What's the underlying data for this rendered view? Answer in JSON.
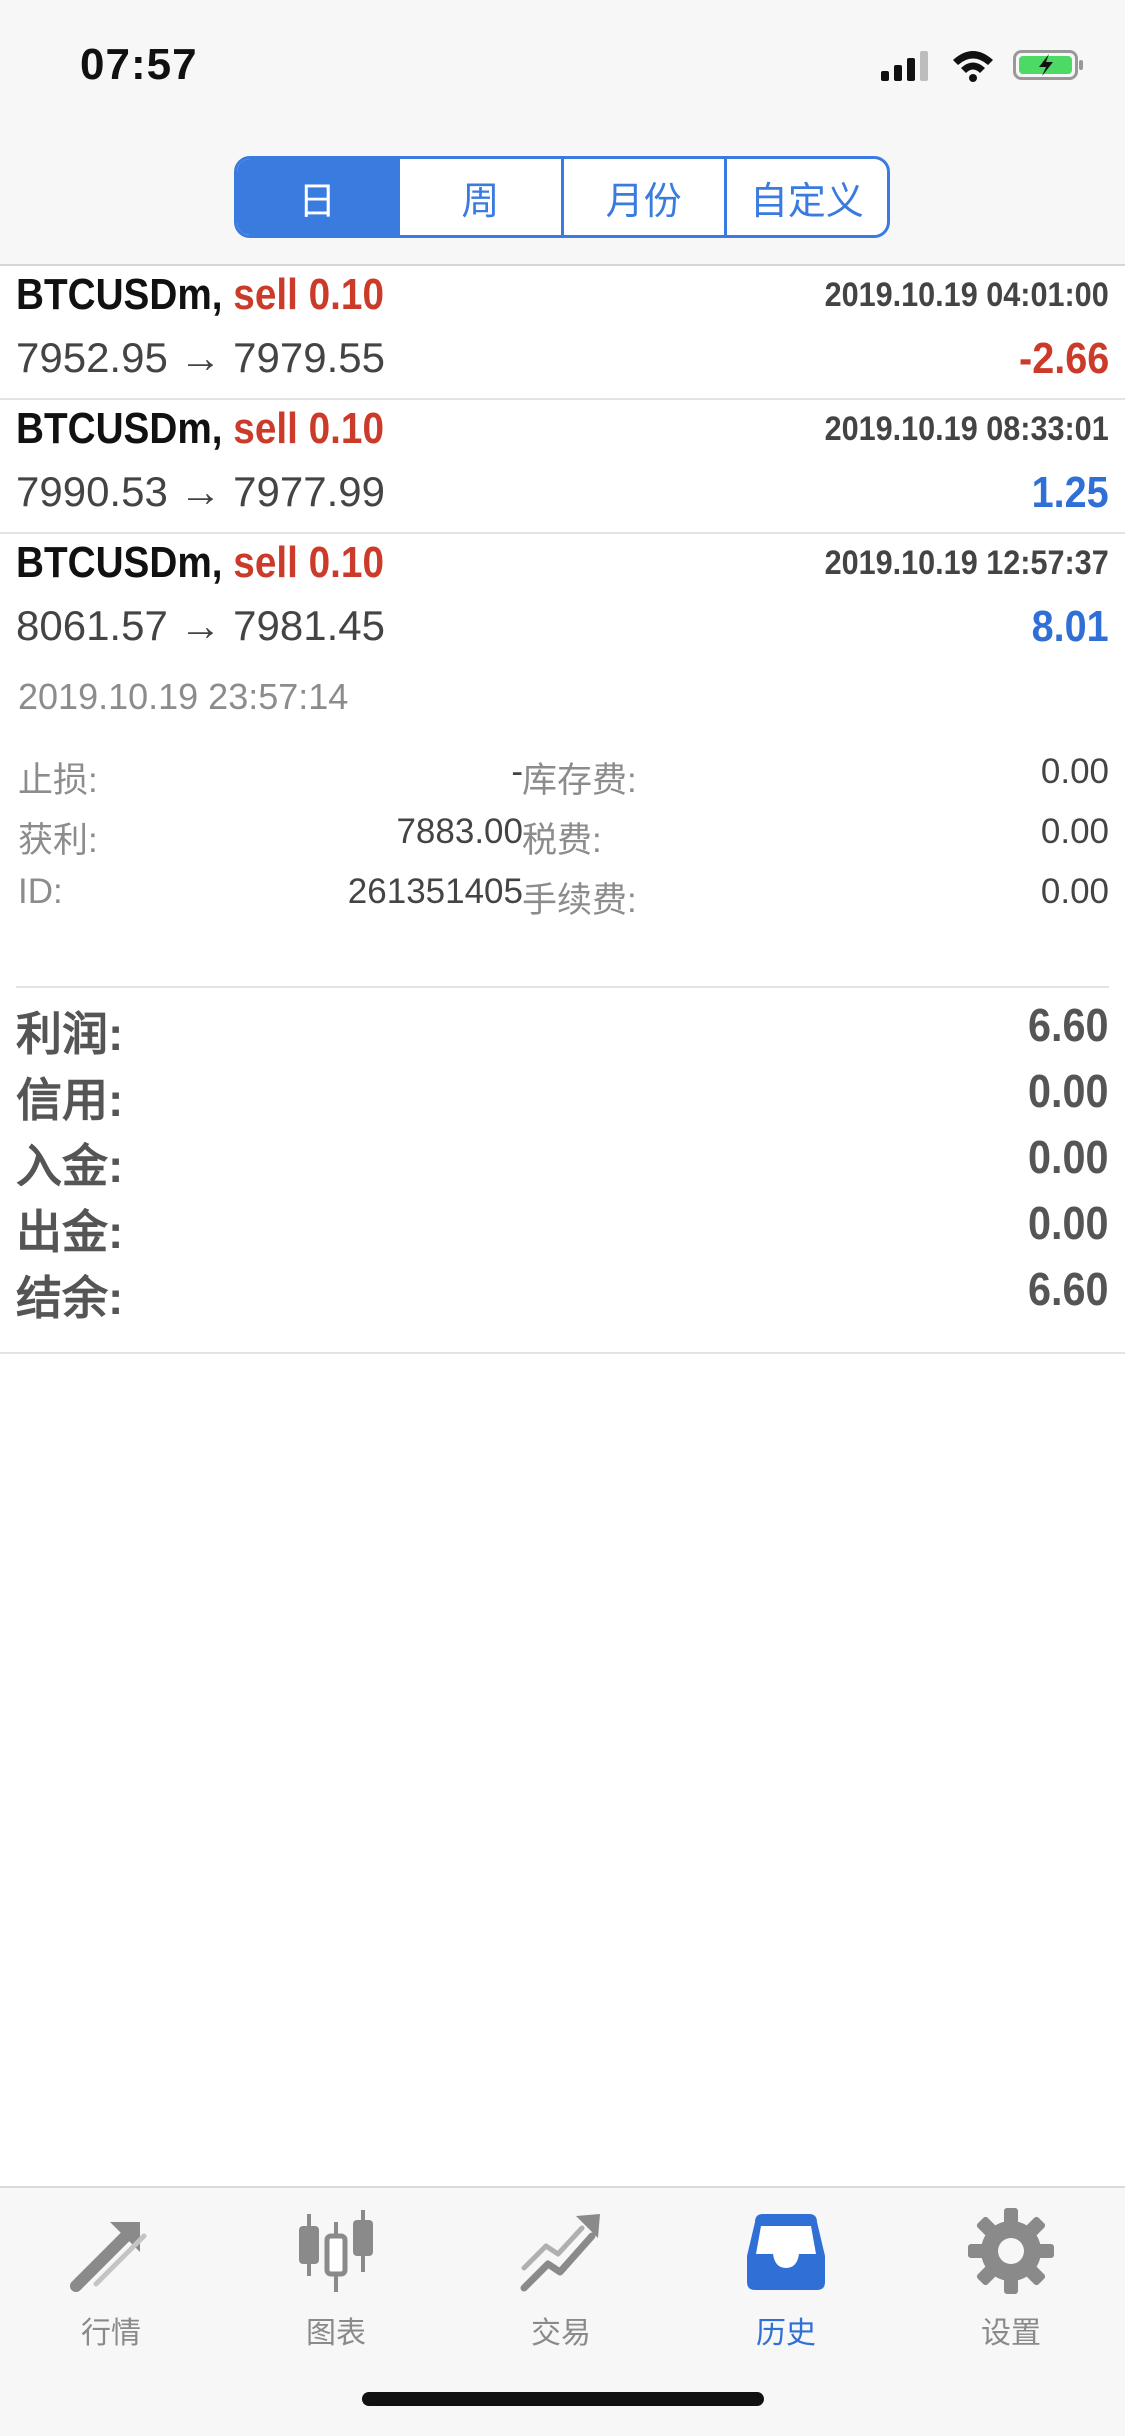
{
  "status_bar": {
    "time": "07:57"
  },
  "period_tabs": [
    {
      "label": "日",
      "active": true
    },
    {
      "label": "周",
      "active": false
    },
    {
      "label": "月份",
      "active": false
    },
    {
      "label": "自定义",
      "active": false
    }
  ],
  "trades": [
    {
      "symbol": "BTCUSDm,",
      "side": "sell 0.10",
      "time": "2019.10.19 04:01:00",
      "price": "7952.95 → 7979.55",
      "profit": "-2.66"
    },
    {
      "symbol": "BTCUSDm,",
      "side": "sell 0.10",
      "time": "2019.10.19 08:33:01",
      "price": "7990.53 → 7977.99",
      "profit": "1.25"
    },
    {
      "symbol": "BTCUSDm,",
      "side": "sell 0.10",
      "time": "2019.10.19 12:57:37",
      "price": "8061.57 → 7981.45",
      "profit": "8.01"
    }
  ],
  "expanded": {
    "close_time": "2019.10.19 23:57:14",
    "rows": [
      {
        "label": "止损:",
        "value": "-",
        "label2": "库存费:",
        "value2": "0.00"
      },
      {
        "label": "获利:",
        "value": "7883.00",
        "label2": "税费:",
        "value2": "0.00"
      },
      {
        "label": "ID:",
        "value": "261351405",
        "label2": "手续费:",
        "value2": "0.00"
      }
    ]
  },
  "summary": [
    {
      "label": "利润:",
      "value": "6.60"
    },
    {
      "label": "信用:",
      "value": "0.00"
    },
    {
      "label": "入金:",
      "value": "0.00"
    },
    {
      "label": "出金:",
      "value": "0.00"
    },
    {
      "label": "结余:",
      "value": "6.60"
    }
  ],
  "tab_bar": [
    {
      "label": "行情",
      "icon": "quotes-icon"
    },
    {
      "label": "图表",
      "icon": "chart-icon"
    },
    {
      "label": "交易",
      "icon": "trade-icon"
    },
    {
      "label": "历史",
      "icon": "history-icon",
      "active": true
    },
    {
      "label": "设置",
      "icon": "gear-icon"
    }
  ],
  "colors": {
    "accent": "#3a7be0",
    "loss": "#cc3b2a",
    "gain": "#2f6fd6"
  }
}
